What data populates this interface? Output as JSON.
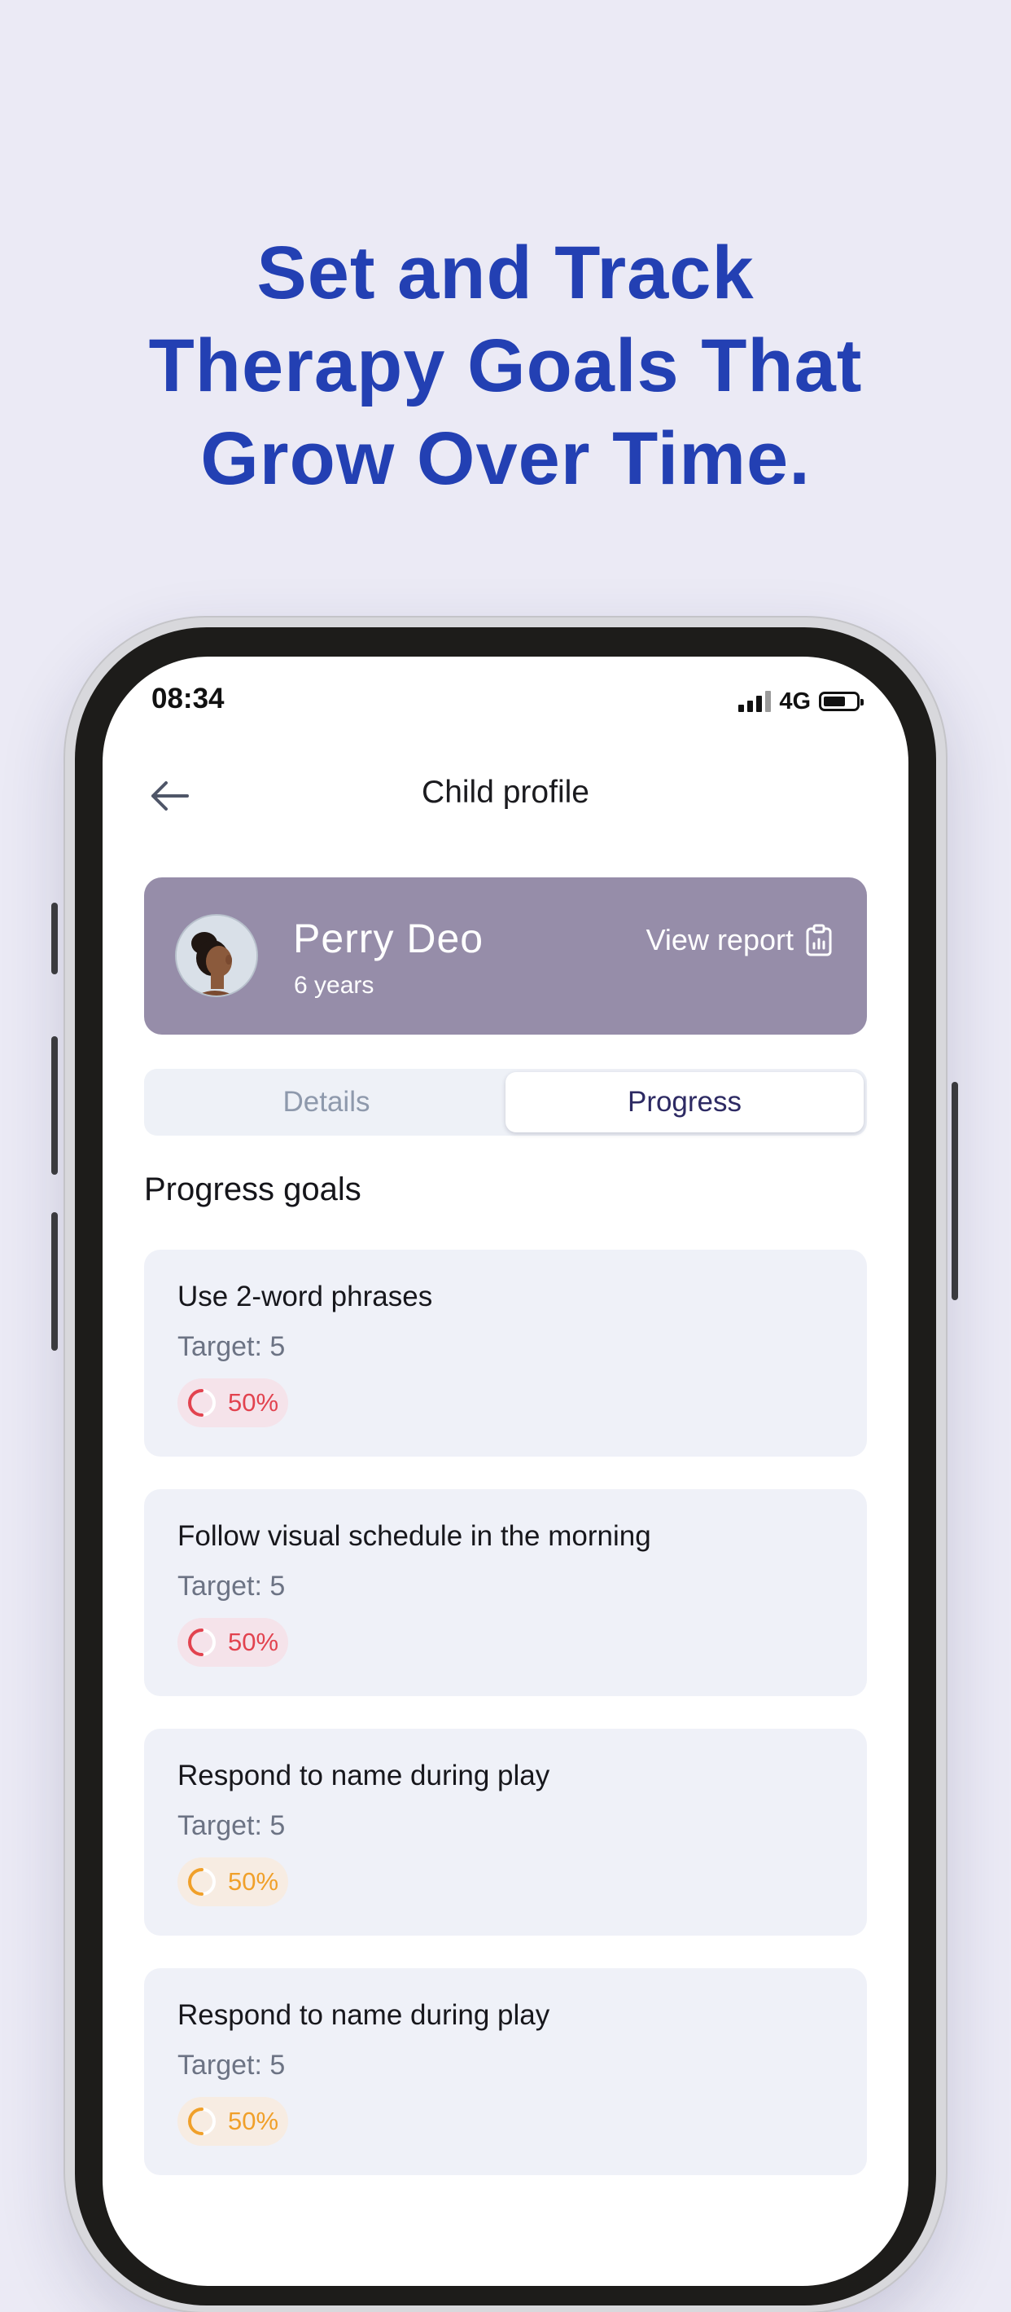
{
  "headline": {
    "line1": "Set and Track",
    "line2": "Therapy Goals That",
    "line3": "Grow Over Time."
  },
  "status_bar": {
    "time": "08:34",
    "network": "4G"
  },
  "nav": {
    "back_icon": "arrow-left-icon",
    "title": "Child profile"
  },
  "profile": {
    "name": "Perry Deo",
    "age": "6 years",
    "view_report_label": "View report",
    "report_icon": "clipboard-chart-icon",
    "card_color": "#968da9"
  },
  "tabs": {
    "details": "Details",
    "progress": "Progress",
    "active": "progress"
  },
  "goals_section": {
    "title": "Progress goals",
    "items": [
      {
        "title": "Use 2-word phrases",
        "target": "Target: 5",
        "percent": "50%",
        "progress": 0.5,
        "status_color": "#e2434f"
      },
      {
        "title": "Follow visual schedule in the morning",
        "target": "Target: 5",
        "percent": "50%",
        "progress": 0.5,
        "status_color": "#e2434f"
      },
      {
        "title": "Respond to name during play",
        "target": "Target: 5",
        "percent": "50%",
        "progress": 0.5,
        "status_color": "#f0a02a"
      },
      {
        "title": "Respond to name during play",
        "target": "Target: 5",
        "percent": "50%",
        "progress": 0.5,
        "status_color": "#f0a02a"
      }
    ]
  },
  "colors": {
    "background": "#ebeaf5",
    "headline": "#2340b3",
    "accent_red": "#e2434f",
    "accent_orange": "#f0a02a"
  }
}
